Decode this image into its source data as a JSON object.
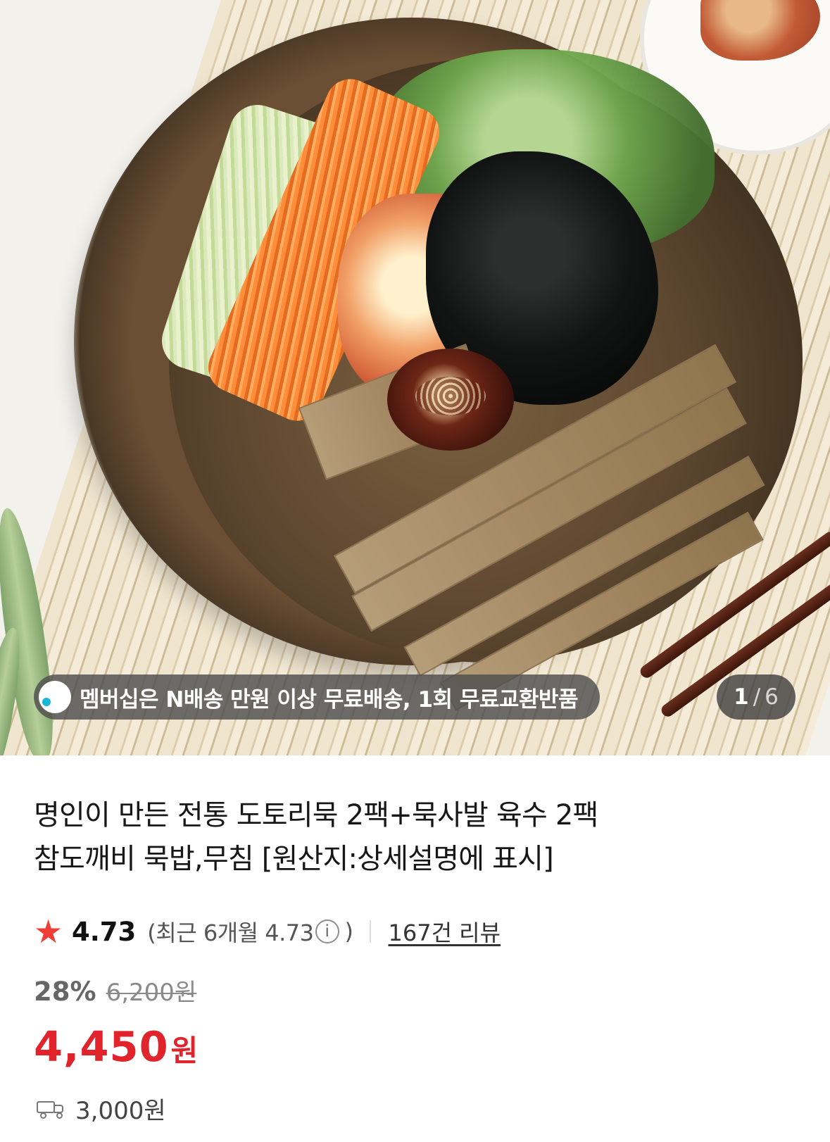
{
  "product_gallery": {
    "membership_notice": "멤버십은 N배송 만원 이상 무료배송, 1회 무료교환반품",
    "image_counter": {
      "current": "1",
      "separator": "/",
      "total": "6"
    },
    "icons": {
      "membership": "globe-icon",
      "image": "food-photo-icon"
    }
  },
  "product": {
    "title_line1": "명인이 만든 전통 도토리묵 2팩+묵사발 육수 2팩",
    "title_line2": "참도깨비 묵밥,무침 [원산지:상세설명에 표시]",
    "rating": {
      "star_icon": "star-icon",
      "score": "4.73",
      "recent_label": "(최근 6개월 4.73",
      "info_icon": "i",
      "recent_close": ")",
      "review_count": "167건 리뷰"
    },
    "pricing": {
      "discount": "28%",
      "original_price": "6,200원",
      "sale_price": "4,450",
      "currency": "원"
    },
    "shipping": {
      "icon": "truck-icon",
      "fee": "3,000원"
    }
  },
  "colors": {
    "price_red": "#e1232b",
    "rating_star": "#f23d36",
    "text_dark": "#171717",
    "text_muted": "#666666"
  }
}
